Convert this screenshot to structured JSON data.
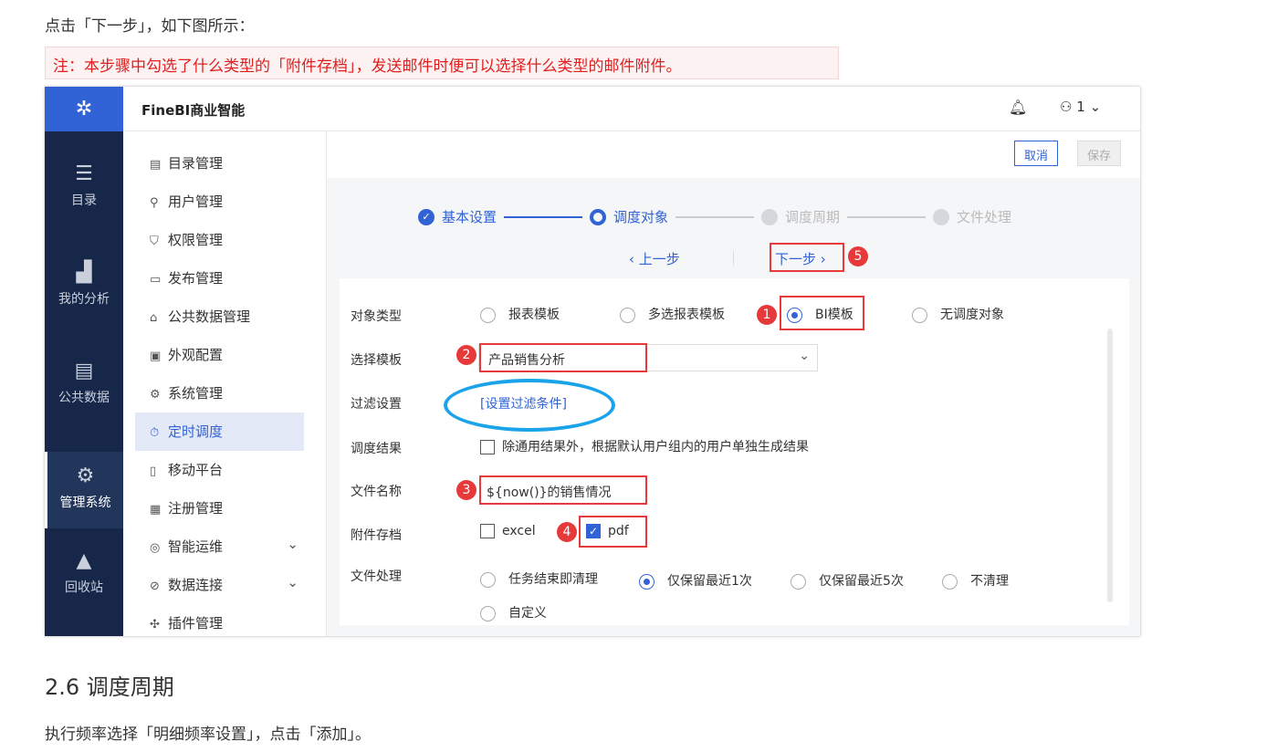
{
  "doc": {
    "intro": "点击「下一步」，如下图所示：",
    "note": "注：本步骤中勾选了什么类型的「附件存档」，发送邮件时便可以选择什么类型的邮件附件。",
    "heading": "2.6 调度周期",
    "para": "执行频率选择「明细频率设置」，点击「添加」。"
  },
  "app": {
    "brand": "FineBI商业智能",
    "user": "1",
    "dark_nav": [
      {
        "label": "目录",
        "icon": "catalog-icon"
      },
      {
        "label": "我的分析",
        "icon": "chart-icon"
      },
      {
        "label": "公共数据",
        "icon": "database-icon"
      },
      {
        "label": "管理系统",
        "icon": "gear-icon"
      },
      {
        "label": "回收站",
        "icon": "recycle-icon"
      }
    ],
    "nav": [
      {
        "label": "目录管理"
      },
      {
        "label": "用户管理"
      },
      {
        "label": "权限管理"
      },
      {
        "label": "发布管理"
      },
      {
        "label": "公共数据管理"
      },
      {
        "label": "外观配置"
      },
      {
        "label": "系统管理"
      },
      {
        "label": "定时调度"
      },
      {
        "label": "移动平台"
      },
      {
        "label": "注册管理"
      },
      {
        "label": "智能运维"
      },
      {
        "label": "数据连接"
      },
      {
        "label": "插件管理"
      }
    ],
    "cancel": "取消",
    "save": "保存",
    "steps": [
      "基本设置",
      "调度对象",
      "调度周期",
      "文件处理"
    ],
    "prev": "上一步",
    "next": "下一步",
    "form": {
      "type_label": "对象类型",
      "type_options": [
        "报表模板",
        "多选报表模板",
        "BI模板",
        "无调度对象"
      ],
      "template_label": "选择模板",
      "template_value": "产品销售分析",
      "filter_label": "过滤设置",
      "filter_link": "[设置过滤条件]",
      "result_label": "调度结果",
      "result_option": "除通用结果外，根据默认用户组内的用户单独生成结果",
      "filename_label": "文件名称",
      "filename_value": "${now()}的销售情况",
      "attach_label": "附件存档",
      "attach_options": [
        "excel",
        "pdf"
      ],
      "process_label": "文件处理",
      "process_options": [
        "任务结束即清理",
        "仅保留最近1次",
        "仅保留最近5次",
        "不清理",
        "自定义"
      ]
    },
    "badges": [
      "1",
      "2",
      "3",
      "4",
      "5"
    ]
  },
  "colors": {
    "accent": "#3163d6",
    "annotation": "#e63a3a",
    "sidebar": "#16274a",
    "circle": "#1aa3e8"
  }
}
